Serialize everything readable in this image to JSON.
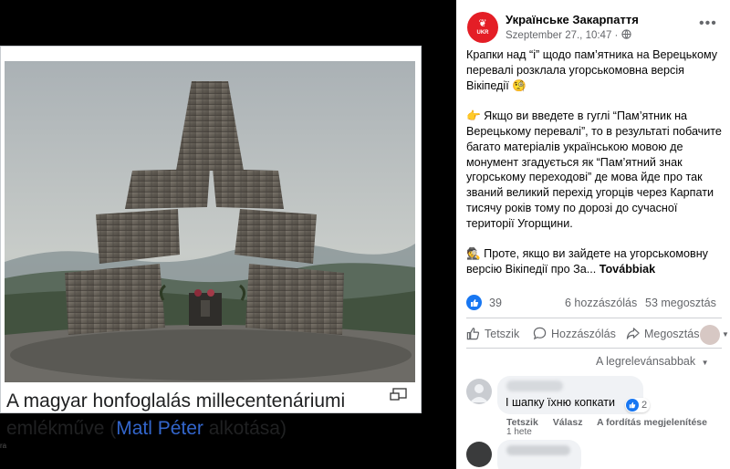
{
  "viewer": {
    "left_edge_text": "re",
    "bottom_edge_text": "ra",
    "caption": {
      "part1": "A magyar honfoglalás millecentenáriumi emlékműve (",
      "link": "Matl Péter",
      "part2": " alkotása)"
    }
  },
  "post": {
    "page_name": "Українське Закарпаття",
    "avatar_text": "UKR",
    "date": "Szeptember 27., 10:47",
    "separator": " · ",
    "more_label": "•••",
    "paragraph1": "Крапки над “і” щодо пам’ятника на Верецькому перевалі розклала угорськомовна версія Вікіпедії 🧐",
    "paragraph2": "👉 Якщо ви введете в гуглі “Пам’ятник на Верецькому перевалі”, то в результаті побачите багато матеріалів українською мовою де монумент згадується як “Пам’ятний знак угорському переходові” де мова йде про так званий великий перехід угорців через Карпати тисячу років тому по дорозі до сучасної території Угорщини.",
    "paragraph3": "🕵 Проте, якщо ви зайдете на угорськомовну версію Вікіпедії про За...",
    "see_more": "Továbbiak"
  },
  "stats": {
    "likes": "39",
    "comments": "6 hozzászólás",
    "shares": "53 megosztás"
  },
  "actions": {
    "like": "Tetszik",
    "comment": "Hozzászólás",
    "share": "Megosztás"
  },
  "sort_label": "A legrelevánsabbak",
  "comment": {
    "text": "І шапку їхню копкати",
    "reactions": "2",
    "like": "Tetszik",
    "reply": "Válasz",
    "translate": "A fordítás megjelenítése",
    "time": "1 hete"
  },
  "colors": {
    "accent": "#1877f2",
    "brand_red": "#e41e26",
    "link": "#3366cc",
    "secondary_text": "#65676b"
  }
}
